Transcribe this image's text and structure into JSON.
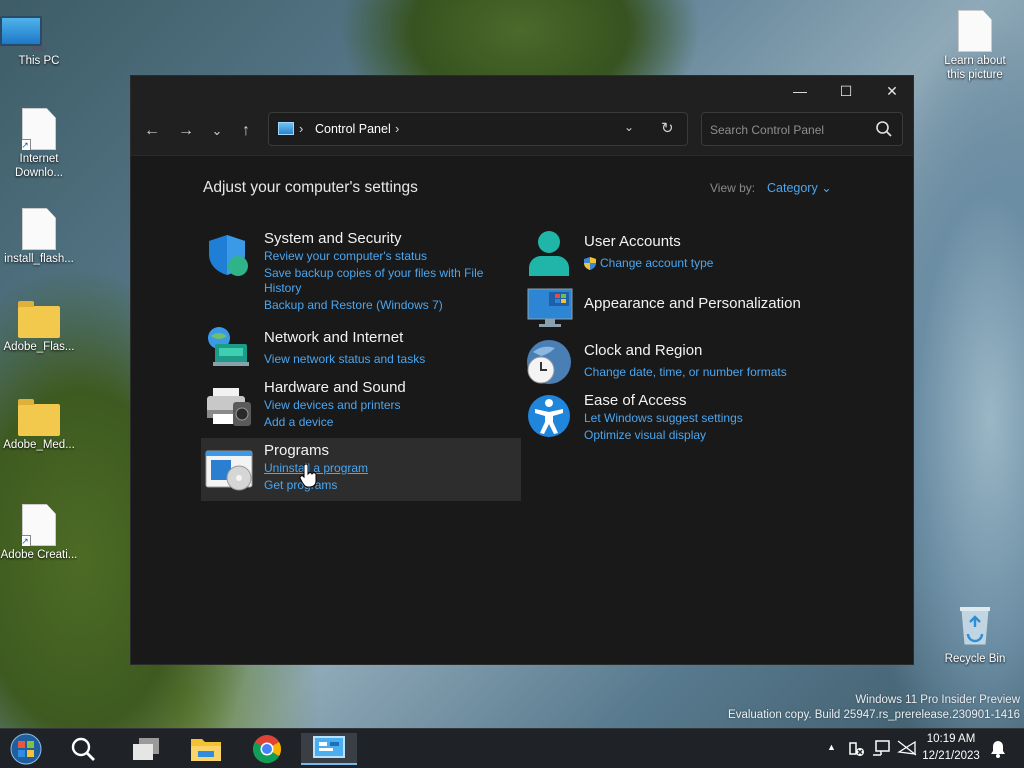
{
  "desktop": {
    "icons": [
      {
        "label": "This PC"
      },
      {
        "label": "Internet Downlo..."
      },
      {
        "label": "install_flash..."
      },
      {
        "label": "Adobe_Flas..."
      },
      {
        "label": "Adobe_Med..."
      },
      {
        "label": "Adobe Creati..."
      },
      {
        "label": "Learn about this picture"
      },
      {
        "label": "Recycle Bin"
      }
    ],
    "watermark": {
      "line1": "Windows 11 Pro Insider Preview",
      "line2": "Evaluation copy. Build 25947.rs_prerelease.230901-1416"
    }
  },
  "window": {
    "controls": {
      "minimize": "—",
      "maximize": "☐",
      "close": "✕"
    },
    "nav": {
      "back": "←",
      "forward": "→",
      "recent": "⌄",
      "up": "↑"
    },
    "address": {
      "separator": "›",
      "location": "Control Panel",
      "trailing": "›",
      "dropdown": "⌄",
      "refresh": "↻"
    },
    "search": {
      "placeholder": "Search Control Panel"
    },
    "heading": "Adjust your computer's settings",
    "view_by": {
      "label": "View by:",
      "value": "Category ⌄"
    },
    "categories": {
      "system": {
        "title": "System and Security",
        "links": [
          "Review your computer's status",
          "Save backup copies of your files with File",
          "History",
          "Backup and Restore (Windows 7)"
        ]
      },
      "network": {
        "title": "Network and Internet",
        "links": [
          "View network status and tasks"
        ]
      },
      "hardware": {
        "title": "Hardware and Sound",
        "links": [
          "View devices and printers",
          "Add a device"
        ]
      },
      "programs": {
        "title": "Programs",
        "links": [
          "Uninstall a program",
          "Get programs"
        ]
      },
      "users": {
        "title": "User Accounts",
        "links": [
          "Change account type"
        ]
      },
      "appearance": {
        "title": "Appearance and Personalization",
        "links": []
      },
      "clock": {
        "title": "Clock and Region",
        "links": [
          "Change date, time, or number formats"
        ]
      },
      "ease": {
        "title": "Ease of Access",
        "links": [
          "Let Windows suggest settings",
          "Optimize visual display"
        ]
      }
    }
  },
  "taskbar": {
    "tray_chevron": "▲",
    "time": "10:19 AM",
    "date": "12/21/2023"
  },
  "colors": {
    "link": "#4aa6f0",
    "window_bg": "#191919",
    "accent": "#0078d4"
  }
}
